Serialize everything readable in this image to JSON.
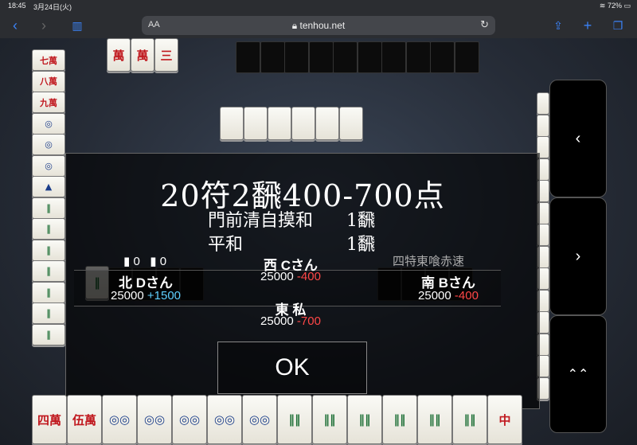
{
  "status": {
    "time": "18:45",
    "date": "3月24日(火)",
    "battery": "72%"
  },
  "browser": {
    "aa": "AA",
    "url": "tenhou.net",
    "back": "‹",
    "forward": "›",
    "reload": "↻"
  },
  "result": {
    "score": "20符2飜400-700点",
    "yaku": [
      {
        "name": "門前清自摸和",
        "han": "1飜"
      },
      {
        "name": "平和",
        "han": "1飜"
      }
    ],
    "counters": {
      "honba": "0",
      "riichi": "0"
    },
    "rule": "四特東喰赤速",
    "players": {
      "north": {
        "name": "北 Dさん",
        "points": "25000",
        "delta": "+1500"
      },
      "west": {
        "name": "西 Cさん",
        "points": "25000",
        "delta": "-400"
      },
      "south": {
        "name": "南 Bさん",
        "points": "25000",
        "delta": "-400"
      },
      "east": {
        "name": "東 私",
        "points": "25000",
        "delta": "-700"
      }
    },
    "ok_label": "OK"
  },
  "nav": {
    "prev": "‹",
    "next": "›",
    "up": "⌃⌃"
  },
  "hand": [
    {
      "g": "四萬",
      "c": "red"
    },
    {
      "g": "伍萬",
      "c": "red"
    },
    {
      "g": "◎◎",
      "c": "blu"
    },
    {
      "g": "◎◎",
      "c": "blu"
    },
    {
      "g": "◎◎",
      "c": "blu"
    },
    {
      "g": "◎◎",
      "c": "blu"
    },
    {
      "g": "◎◎",
      "c": "blu"
    },
    {
      "g": "‖‖",
      "c": "grn"
    },
    {
      "g": "‖‖",
      "c": "grn"
    },
    {
      "g": "‖‖",
      "c": "grn"
    },
    {
      "g": "‖‖",
      "c": "grn"
    },
    {
      "g": "‖‖",
      "c": "grn"
    },
    {
      "g": "‖‖",
      "c": "grn"
    },
    {
      "g": "中",
      "c": "red"
    }
  ]
}
